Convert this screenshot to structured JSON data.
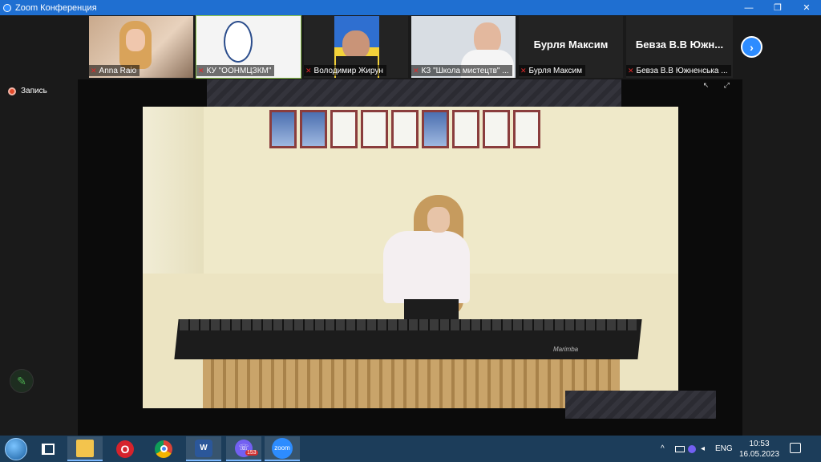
{
  "window": {
    "title": "Zoom Конференция",
    "controls": {
      "minimize": "—",
      "maximize": "❐",
      "close": "✕"
    }
  },
  "participants": [
    {
      "name": "Anna Raio",
      "muted": true,
      "display": "video"
    },
    {
      "name": "КУ \"ООНМЦЗКМ\"",
      "muted": true,
      "display": "logo"
    },
    {
      "name": "Володимир Жирун",
      "muted": true,
      "display": "video"
    },
    {
      "name": "КЗ \"Школа мистецтв\" ...",
      "muted": true,
      "display": "video"
    },
    {
      "name": "Бурля Максим",
      "big_name": "Бурля Максим",
      "muted": true,
      "display": "name"
    },
    {
      "name": "Бевза В.В Южненська ...",
      "big_name": "Бевза В.В Южн...",
      "muted": true,
      "display": "name"
    }
  ],
  "strip_next": "›",
  "recording": {
    "label": "Запись"
  },
  "share": {
    "corner_icons": "↖ ⤢",
    "brand_text": "Marimba"
  },
  "taskbar": {
    "apps": [
      {
        "name": "task-view",
        "label": ""
      },
      {
        "name": "file-explorer",
        "label": ""
      },
      {
        "name": "opera",
        "label": "O"
      },
      {
        "name": "chrome",
        "label": ""
      },
      {
        "name": "word",
        "label": "W"
      },
      {
        "name": "viber",
        "label": "",
        "badge": "153"
      },
      {
        "name": "zoom",
        "label": "zoom"
      }
    ],
    "tray": {
      "chevron": "^",
      "lang": "ENG"
    },
    "clock": {
      "time": "10:53",
      "date": "16.05.2023"
    }
  },
  "colors": {
    "titlebar": "#1f6fd1",
    "taskbar": "#1c3d5a",
    "zoom_blue": "#2d8cff",
    "muted_red": "#e02828",
    "active_green": "#8bc34a"
  }
}
